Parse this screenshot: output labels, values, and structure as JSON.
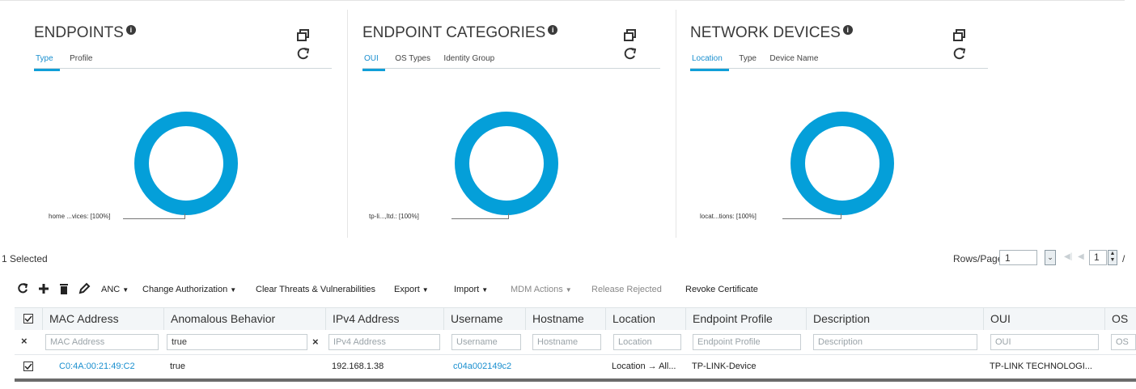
{
  "dashlets": [
    {
      "title": "ENDPOINTS",
      "tabs": [
        "Type",
        "Profile"
      ],
      "active_tab": "Type",
      "legend": "home ...vices: [100%]",
      "chart_data": {
        "type": "pie",
        "categories": [
          "home ...vices"
        ],
        "values": [
          100
        ]
      }
    },
    {
      "title": "ENDPOINT CATEGORIES",
      "tabs": [
        "OUI",
        "OS Types",
        "Identity Group"
      ],
      "active_tab": "OUI",
      "legend": "tp-li...,ltd.: [100%]",
      "chart_data": {
        "type": "pie",
        "categories": [
          "tp-li...,ltd."
        ],
        "values": [
          100
        ]
      }
    },
    {
      "title": "NETWORK DEVICES",
      "tabs": [
        "Location",
        "Type",
        "Device Name"
      ],
      "active_tab": "Location",
      "legend": "locat...tions: [100%]",
      "chart_data": {
        "type": "pie",
        "categories": [
          "locat...tions"
        ],
        "values": [
          100
        ]
      }
    }
  ],
  "info_glyph": "i",
  "selection": {
    "text": "1 Selected"
  },
  "pager": {
    "label": "Rows/Page",
    "rows_per_page": "1",
    "page": "1",
    "slash": "/"
  },
  "toolbar": {
    "anc": "ANC",
    "change_authorization": "Change Authorization",
    "clear_threats": "Clear Threats & Vulnerabilities",
    "export": "Export",
    "import": "Import",
    "mdm_actions": "MDM Actions",
    "release_rejected": "Release Rejected",
    "revoke_certificate": "Revoke Certificate"
  },
  "table": {
    "headers": [
      "MAC Address",
      "Anomalous Behavior",
      "IPv4 Address",
      "Username",
      "Hostname",
      "Location",
      "Endpoint Profile",
      "Description",
      "OUI",
      "OS"
    ],
    "filters": {
      "placeholders": [
        "MAC Address",
        "",
        "IPv4 Address",
        "Username",
        "Hostname",
        "Location",
        "Endpoint Profile",
        "Description",
        "OUI",
        "OS"
      ],
      "anomalous_value": "true"
    },
    "rows": [
      {
        "checked": true,
        "mac": "C0:4A:00:21:49:C2",
        "anomalous": "true",
        "ipv4": "192.168.1.38",
        "username": "c04a002149c2",
        "hostname": "",
        "location": "Location → All...",
        "endpoint_profile": "TP-LINK-Device",
        "description": "",
        "oui": "TP-LINK TECHNOLOGI..."
      }
    ]
  },
  "colors": {
    "accent": "#049fd9",
    "link": "#1a8fcf",
    "header_bg": "#f3f6f8"
  }
}
